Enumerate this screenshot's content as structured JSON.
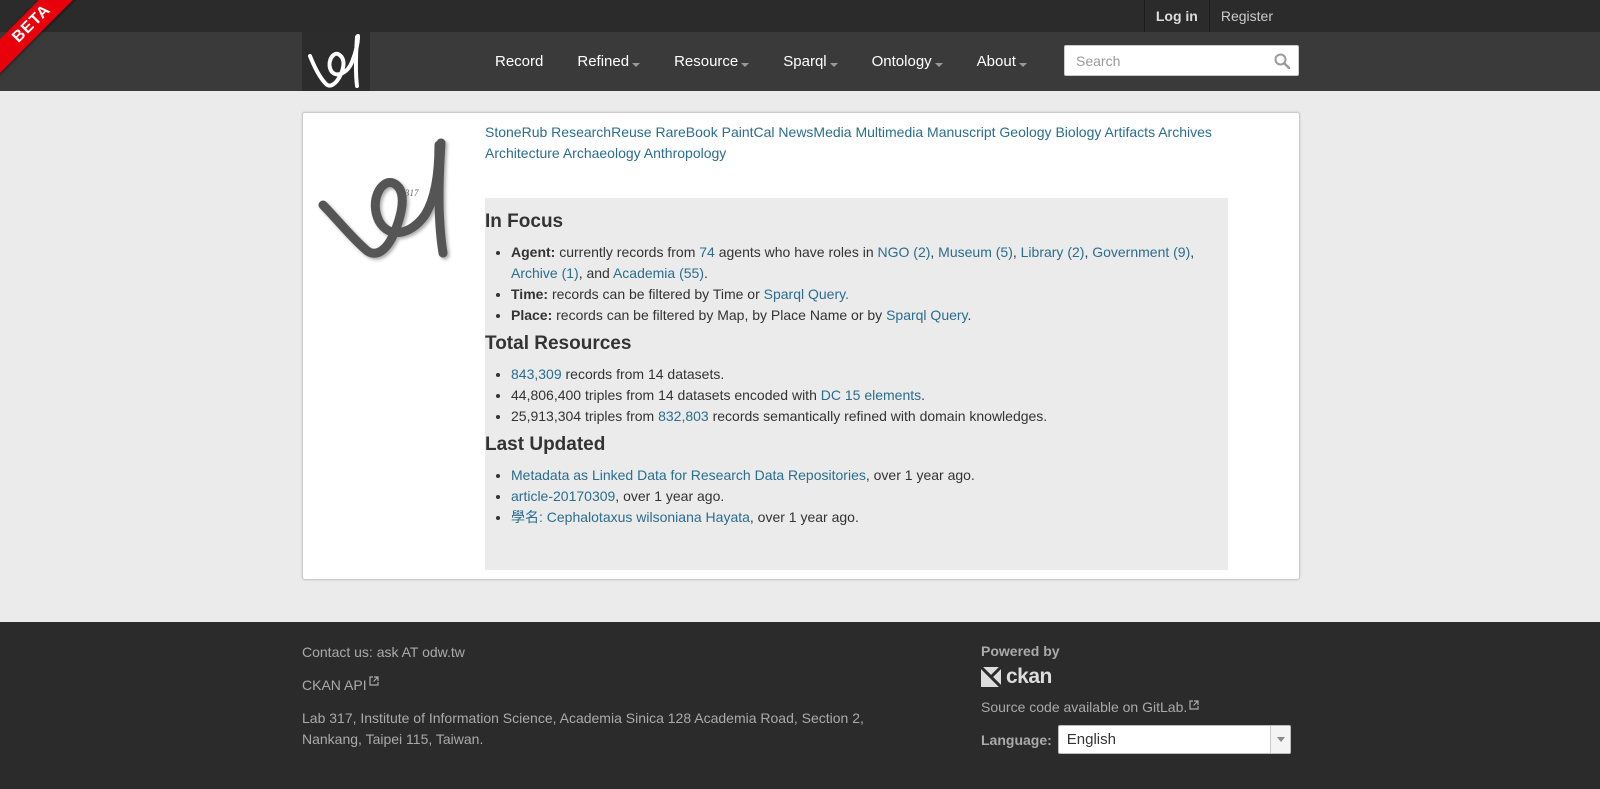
{
  "beta": "BETA",
  "account": {
    "login": "Log in",
    "register": "Register"
  },
  "nav": {
    "items": [
      {
        "label": "Record",
        "dropdown": false
      },
      {
        "label": "Refined",
        "dropdown": true
      },
      {
        "label": "Resource",
        "dropdown": true
      },
      {
        "label": "Sparql",
        "dropdown": true
      },
      {
        "label": "Ontology",
        "dropdown": true
      },
      {
        "label": "About",
        "dropdown": true
      }
    ]
  },
  "search": {
    "placeholder": "Search",
    "icon": "search-icon"
  },
  "categories": [
    "StoneRub",
    "ResearchReuse",
    "RareBook",
    "PaintCal",
    "NewsMedia",
    "Multimedia",
    "Manuscript",
    "Geology",
    "Biology",
    "Artifacts",
    "Archives",
    "Architecture",
    "Archaeology",
    "Anthropology"
  ],
  "focus": {
    "heading": "In Focus",
    "agent": {
      "label": "Agent:",
      "t1": " currently records from ",
      "count": "74",
      "t2": " agents who have roles in ",
      "ngo": "NGO (2)",
      "museum": "Museum (5)",
      "library": "Library (2)",
      "government": "Government (9)",
      "archive": "Archive (1)",
      "t3": ", and ",
      "academia": "Academia (55)",
      "t4": "."
    },
    "time": {
      "label": "Time:",
      "text": " records can be filtered by Time or ",
      "link": "Sparql Query.",
      "end": ""
    },
    "place": {
      "label": "Place:",
      "text": " records can be filtered by Map, by Place Name or by ",
      "link": "Sparql Query",
      "end": "."
    }
  },
  "resources": {
    "heading": "Total Resources",
    "r1": {
      "link": "843,309",
      "text": " records from 14 datasets."
    },
    "r2": {
      "text": "44,806,400 triples from 14 datasets encoded with ",
      "link": "DC 15 elements",
      "end": "."
    },
    "r3": {
      "text": "25,913,304 triples from ",
      "link": "832,803",
      "end": " records semantically refined with domain knowledges."
    }
  },
  "updated": {
    "heading": "Last Updated",
    "items": [
      {
        "link": "Metadata as Linked Data for Research Data Repositories",
        "text": ", over 1 year ago."
      },
      {
        "link": "article-20170309",
        "text": ", over 1 year ago."
      },
      {
        "link": "學名: Cephalotaxus wilsoniana Hayata",
        "text": ", over 1 year ago."
      }
    ]
  },
  "footer": {
    "contact": "Contact us: ask AT odw.tw",
    "api": "CKAN API",
    "address": "Lab 317, Institute of Information Science, Academia Sinica 128 Academia Road, Section 2, Nankang, Taipei 115, Taiwan.",
    "powered": "Powered by",
    "ckan": "ckan",
    "source": "Source code available on GitLab.",
    "language_label": "Language:",
    "language_value": "English"
  },
  "logo_text": "317",
  "colors": {
    "link": "#2a6d8e",
    "header": "#3a3a3a",
    "topbar": "#2b2b2b",
    "beta": "#e8000b"
  }
}
